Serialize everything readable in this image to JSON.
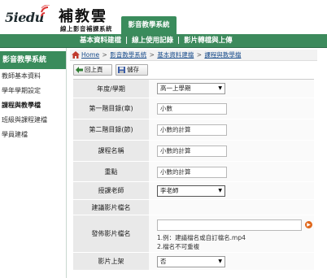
{
  "header": {
    "logo_text": "5iedu",
    "brand_title": "補教雲",
    "brand_subtitle": "線上影音補課系統",
    "active_tab": "影音教學系統"
  },
  "navbar": {
    "links": [
      "基本資料建檔",
      "線上使用記錄",
      "影片轉檔與上傳"
    ],
    "separator": "|"
  },
  "sidebar": {
    "title": "影音教學系統",
    "items": [
      {
        "label": "教師基本資料"
      },
      {
        "label": "學年學期設定"
      },
      {
        "label": "課程與教學檔"
      },
      {
        "label": "班級與課程建檔"
      },
      {
        "label": "學員建檔"
      }
    ]
  },
  "breadcrumb": {
    "home": "Home",
    "crumbs": [
      "影音教學系統",
      "基本資料建檔",
      "課程與教學檔"
    ],
    "separator": ">"
  },
  "toolbar": {
    "back_label": "回上頁",
    "save_label": "儲存"
  },
  "form": {
    "year_term": {
      "label": "年度/學期",
      "value": "高一上學期"
    },
    "catalog_1": {
      "label": "第一階目錄(章)",
      "value": "小數"
    },
    "catalog_2": {
      "label": "第二階目錄(節)",
      "value": "小數的計算"
    },
    "course_name": {
      "label": "課程名稱",
      "value": "小數的計算"
    },
    "key_point": {
      "label": "重點",
      "value": "小數的計算"
    },
    "teacher": {
      "label": "授課老師",
      "value": "李老師"
    },
    "video_file": {
      "label": "建議影片檔名",
      "value": ""
    },
    "publish_file": {
      "label": "發佈影片檔名",
      "value": "",
      "hint_1": "1.例：建議檔名或自訂檔名.mp4",
      "hint_2": "2.檔名不可重複"
    },
    "video_upload": {
      "label": "影片上架",
      "value": "否"
    }
  },
  "colors": {
    "brand_green": "#3a8c5c",
    "accent_orange": "#e0671b",
    "link_blue": "#1a4d8c"
  }
}
